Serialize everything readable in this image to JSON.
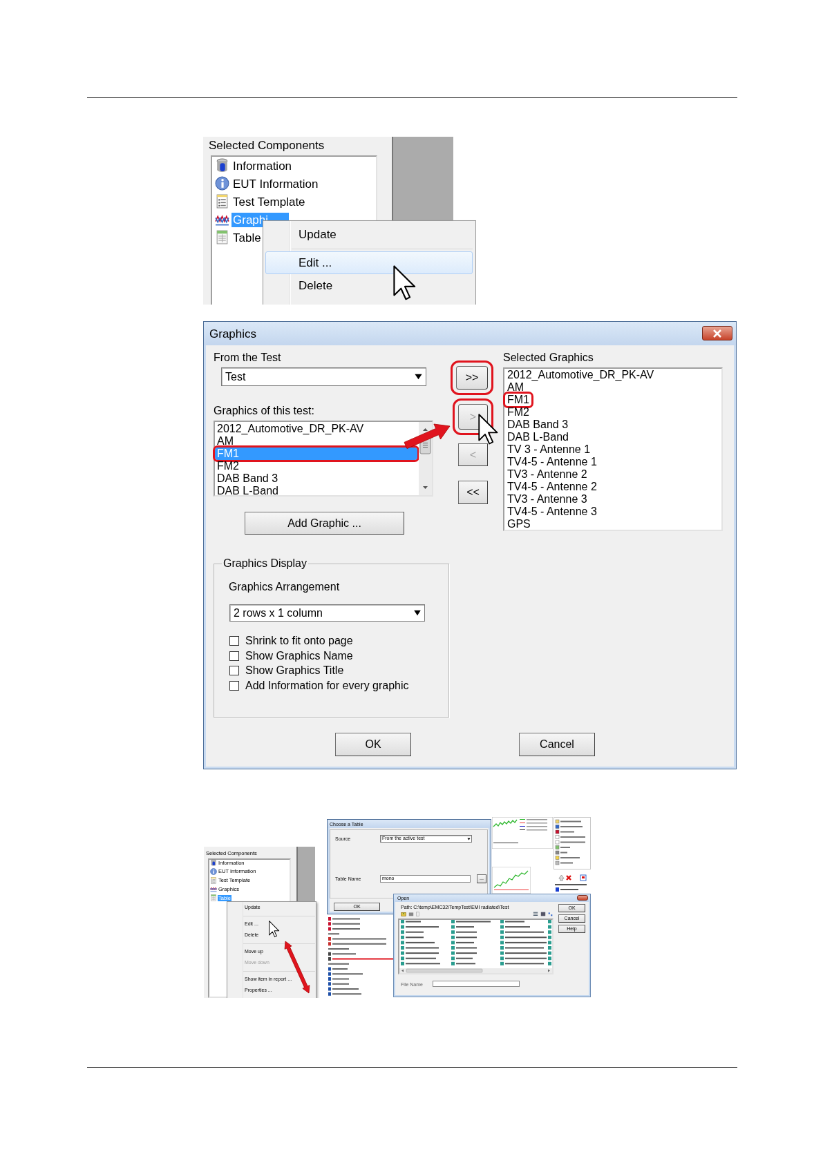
{
  "context_menu_shot": {
    "panel_title": "Selected Components",
    "items": [
      {
        "label": "Information",
        "kind": "database",
        "selected": false
      },
      {
        "label": "EUT Information",
        "kind": "info",
        "selected": false
      },
      {
        "label": "Test Template",
        "kind": "template",
        "selected": false
      },
      {
        "label": "Graphi",
        "kind": "graph",
        "selected": true
      },
      {
        "label": "Table",
        "kind": "table",
        "selected": false
      }
    ],
    "menu": [
      {
        "kind": "item",
        "label": "Update",
        "highlighted": false
      },
      {
        "kind": "separator"
      },
      {
        "kind": "item",
        "label": "Edit ...",
        "highlighted": true
      },
      {
        "kind": "item",
        "label": "Delete",
        "highlighted": false
      }
    ]
  },
  "graphics_dialog": {
    "title": "Graphics",
    "from_label": "From the Test",
    "from_value": "Test",
    "list_label": "Graphics of this test:",
    "available": [
      {
        "label": "2012_Automotive_DR_PK-AV",
        "selected": false,
        "highlighted": false
      },
      {
        "label": "AM",
        "selected": false,
        "highlighted": false
      },
      {
        "label": "FM1",
        "selected": true,
        "highlighted": true
      },
      {
        "label": "FM2",
        "selected": false,
        "highlighted": false
      },
      {
        "label": "DAB Band 3",
        "selected": false,
        "highlighted": false
      },
      {
        "label": "DAB L-Band",
        "selected": false,
        "highlighted": false
      }
    ],
    "transfer_buttons": [
      {
        "label": ">>",
        "disabled": false,
        "highlighted": true
      },
      {
        "label": ">",
        "disabled": true,
        "highlighted": true
      },
      {
        "label": "<",
        "disabled": true,
        "highlighted": false
      },
      {
        "label": "<<",
        "disabled": false,
        "highlighted": false
      }
    ],
    "add_button": "Add Graphic ...",
    "selected_label": "Selected Graphics",
    "selected_graphics": [
      {
        "label": "2012_Automotive_DR_PK-AV",
        "highlighted": false
      },
      {
        "label": "AM",
        "highlighted": false
      },
      {
        "label": "FM1",
        "highlighted": true
      },
      {
        "label": "FM2",
        "highlighted": false
      },
      {
        "label": "DAB Band 3",
        "highlighted": false
      },
      {
        "label": "DAB L-Band",
        "highlighted": false
      },
      {
        "label": "TV 3 - Antenne 1",
        "highlighted": false
      },
      {
        "label": "TV4-5 - Antenne 1",
        "highlighted": false
      },
      {
        "label": "TV3 - Antenne 2",
        "highlighted": false
      },
      {
        "label": "TV4-5 - Antenne 2",
        "highlighted": false
      },
      {
        "label": "TV3 - Antenne 3",
        "highlighted": false
      },
      {
        "label": "TV4-5 - Antenne 3",
        "highlighted": false
      },
      {
        "label": "GPS",
        "highlighted": false
      }
    ],
    "display_group": "Graphics Display",
    "arrangement_label": "Graphics Arrangement",
    "arrangement_value": "2 rows x 1 column",
    "options": [
      {
        "label": "Shrink to fit onto page",
        "checked": false
      },
      {
        "label": "Show Graphics Name",
        "checked": false
      },
      {
        "label": "Show Graphics Title",
        "checked": false
      },
      {
        "label": "Add Information for every graphic",
        "checked": false
      }
    ],
    "buttons": [
      "OK",
      "Cancel"
    ]
  },
  "collage": {
    "components": {
      "panel_title": "Selected Components",
      "items": [
        {
          "label": "Information",
          "kind": "database",
          "selected": false
        },
        {
          "label": "EUT Information",
          "kind": "info",
          "selected": false
        },
        {
          "label": "Test Template",
          "kind": "template",
          "selected": false
        },
        {
          "label": "Graphics",
          "kind": "graph",
          "selected": false
        },
        {
          "label": "Table",
          "kind": "table",
          "selected": true
        }
      ],
      "menu": [
        {
          "kind": "item",
          "label": "Update",
          "disabled": false
        },
        {
          "kind": "separator"
        },
        {
          "kind": "item",
          "label": "Edit ...",
          "disabled": false
        },
        {
          "kind": "item",
          "label": "Delete",
          "disabled": false
        },
        {
          "kind": "separator"
        },
        {
          "kind": "item",
          "label": "Move up",
          "disabled": false
        },
        {
          "kind": "item",
          "label": "Move down",
          "disabled": true
        },
        {
          "kind": "separator"
        },
        {
          "kind": "item",
          "label": "Show item in report ...",
          "disabled": false
        },
        {
          "kind": "item",
          "label": "Properties ...",
          "disabled": false
        }
      ]
    },
    "choose_table": {
      "title": "Choose a Table",
      "source_label": "Source",
      "source_value": "From the active test",
      "name_label": "Table Name",
      "name_value": "mono",
      "browse": "...",
      "ok": "OK"
    },
    "open_dialog": {
      "title": "Open",
      "path": "Path: C:\\temp\\EMC32\\TempTest\\EMI radiated\\Test",
      "file_name_label": "File Name",
      "buttons": [
        "OK",
        "Cancel",
        "Help"
      ]
    }
  }
}
